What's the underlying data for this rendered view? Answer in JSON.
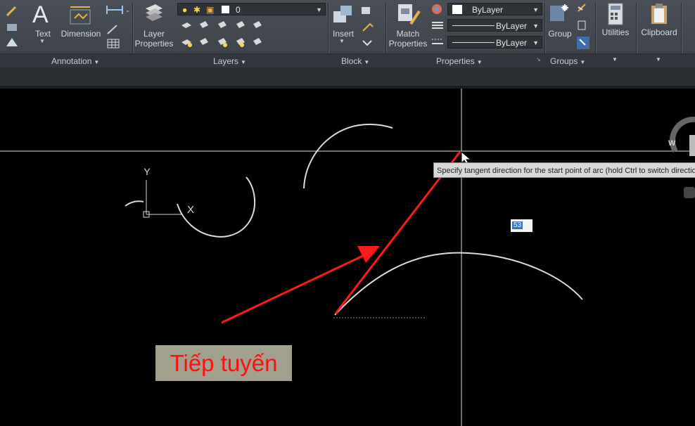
{
  "ribbon": {
    "panels": {
      "annotation": "Annotation",
      "layers": "Layers",
      "block": "Block",
      "properties": "Properties",
      "groups": "Groups"
    },
    "buttons": {
      "text": "Text",
      "dimension": "Dimension",
      "layer_properties": "Layer\nProperties",
      "insert": "Insert",
      "match_properties": "Match\nProperties",
      "group": "Group",
      "utilities": "Utilities",
      "clipboard": "Clipboard"
    },
    "layer_dropdown": {
      "value": "0"
    },
    "properties_dropdowns": {
      "color": "ByLayer",
      "linetype": "ByLayer",
      "lineweight": "ByLayer"
    }
  },
  "canvas": {
    "ucs_y": "Y",
    "ucs_x": "X",
    "nav_compass": "W",
    "tooltip": "Specify tangent direction for the start point of arc (hold Ctrl to switch direction):",
    "dynamic_input": "53"
  },
  "annotation": {
    "caption": "Tiếp tuyến",
    "color": "#ff1a1a"
  }
}
